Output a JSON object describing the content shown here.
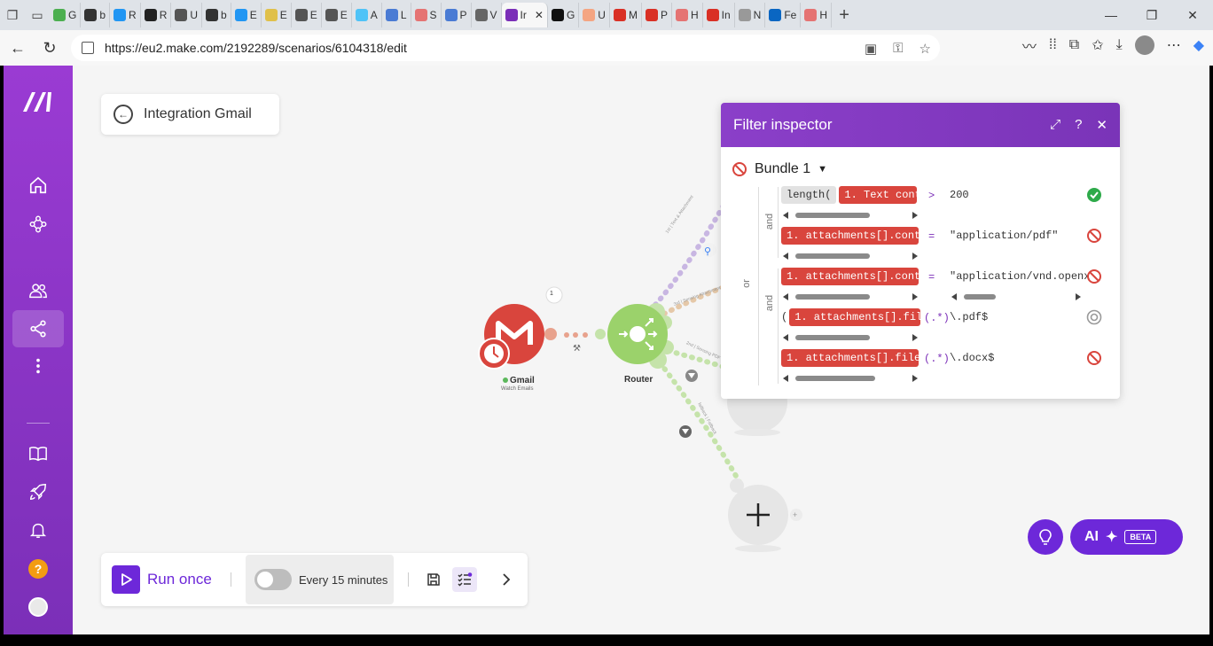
{
  "browser": {
    "tabs": [
      {
        "label": "G",
        "color": "#4caf50"
      },
      {
        "label": "b",
        "color": "#333333"
      },
      {
        "label": "R",
        "color": "#2196f3"
      },
      {
        "label": "R",
        "color": "#222222"
      },
      {
        "label": "U",
        "color": "#555555"
      },
      {
        "label": "b",
        "color": "#333333"
      },
      {
        "label": "E",
        "color": "#2196f3"
      },
      {
        "label": "E",
        "color": "#e0c04a"
      },
      {
        "label": "E",
        "color": "#555555"
      },
      {
        "label": "E",
        "color": "#555555"
      },
      {
        "label": "A",
        "color": "#4fc3f7"
      },
      {
        "label": "L",
        "color": "#4a7bd4"
      },
      {
        "label": "S",
        "color": "#e57373"
      },
      {
        "label": "P",
        "color": "#4a7bd4"
      },
      {
        "label": "V",
        "color": "#666666"
      },
      {
        "label": "Ir",
        "color": "#7b2fb8",
        "active": true
      },
      {
        "label": "G",
        "color": "#111111"
      },
      {
        "label": "U",
        "color": "#f4a582"
      },
      {
        "label": "M",
        "color": "#d93025"
      },
      {
        "label": "P",
        "color": "#d93025"
      },
      {
        "label": "H",
        "color": "#e57373"
      },
      {
        "label": "In",
        "color": "#d93025"
      },
      {
        "label": "N",
        "color": "#999999"
      },
      {
        "label": "Fe",
        "color": "#0a66c2"
      },
      {
        "label": "H",
        "color": "#e57373"
      }
    ],
    "url": "https://eu2.make.com/2192289/scenarios/6104318/edit"
  },
  "scenario": {
    "title": "Integration Gmail"
  },
  "nodes": {
    "gmail": {
      "label": "Gmail",
      "sub": "Watch Emails",
      "badge": "1"
    },
    "router": {
      "label": "Router"
    }
  },
  "routes": {
    "r1": "1st | Text & Attachment",
    "r2": "3rd | Sensing Attachment",
    "r3": "2nd | Sensing PDF",
    "r4": "fallback | Fallback"
  },
  "inspector": {
    "title": "Filter inspector",
    "bundle": "Bundle 1",
    "logic_and_1": "and",
    "logic_or": "or",
    "logic_and_2": "and",
    "conditions": [
      {
        "fn": "length(",
        "field": "1. Text cont",
        "op": ">",
        "value": "200",
        "status": "pass"
      },
      {
        "field": "1. attachments[].cont",
        "op": "=",
        "value": "\"application/pdf\"",
        "status": "fail"
      },
      {
        "field": "1. attachments[].cont",
        "op": "=",
        "value": "\"application/vnd.openx",
        "status": "fail"
      },
      {
        "prefix": "(",
        "field": "1. attachments[].fil",
        "op": "(.*)",
        "value": "\\.pdf$",
        "status": "neutral"
      },
      {
        "field": "1. attachments[].file",
        "op": "(.*)",
        "value": "\\.docx$",
        "status": "fail"
      }
    ]
  },
  "toolbar": {
    "run_label": "Run once",
    "schedule": "Every 15 minutes"
  },
  "ai": {
    "label": "AI",
    "beta": "BETA"
  },
  "colors": {
    "brand": "#7b2fb8",
    "accent": "#6d28d9",
    "gmail": "#d9453d",
    "router": "#9bd26b"
  }
}
